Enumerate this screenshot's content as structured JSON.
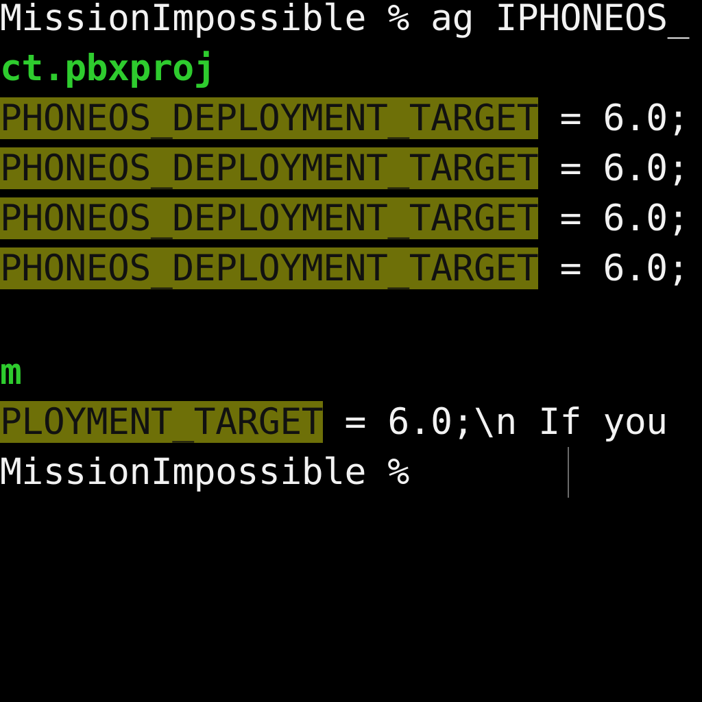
{
  "terminal": {
    "background": "#000000",
    "match_highlight": "#6e7008",
    "path_color": "#2ecc2e",
    "command_line": {
      "prompt": "MissionImpossible %",
      "command": " ag IPHONEOS_"
    },
    "file1_path": "ct.pbxproj",
    "matches": [
      {
        "match": "PHONEOS_DEPLOYMENT_TARGET",
        "rest": " = 6.0;"
      },
      {
        "match": "PHONEOS_DEPLOYMENT_TARGET",
        "rest": " = 6.0;"
      },
      {
        "match": "PHONEOS_DEPLOYMENT_TARGET",
        "rest": " = 6.0;"
      },
      {
        "match": "PHONEOS_DEPLOYMENT_TARGET",
        "rest": " = 6.0;"
      }
    ],
    "file2_path": "m",
    "file2_match": {
      "match": "PLOYMENT_TARGET",
      "rest": " = 6.0;\\n If you "
    },
    "final_prompt": "MissionImpossible %"
  }
}
